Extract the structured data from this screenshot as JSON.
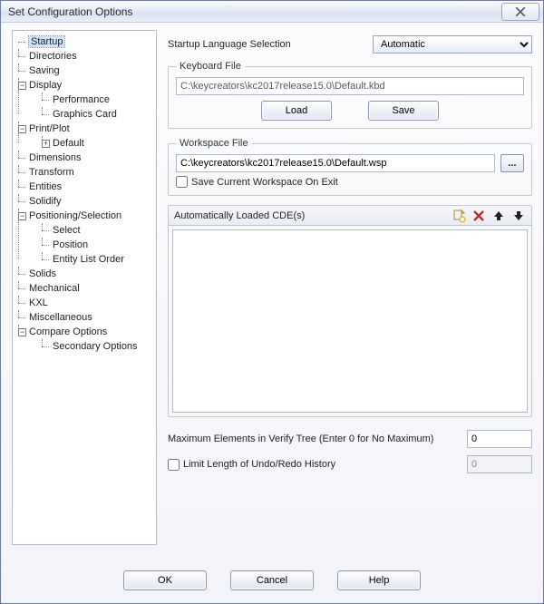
{
  "window": {
    "title": "Set Configuration Options"
  },
  "tree": {
    "items": [
      {
        "label": "Startup",
        "selected": true
      },
      {
        "label": "Directories"
      },
      {
        "label": "Saving"
      },
      {
        "label": "Display",
        "expander": "-",
        "children": [
          {
            "label": "Performance"
          },
          {
            "label": "Graphics Card"
          }
        ]
      },
      {
        "label": "Print/Plot",
        "expander": "-",
        "children": [
          {
            "label": "Default",
            "expander": "+"
          }
        ]
      },
      {
        "label": "Dimensions"
      },
      {
        "label": "Transform"
      },
      {
        "label": "Entities"
      },
      {
        "label": "Solidify"
      },
      {
        "label": "Positioning/Selection",
        "expander": "-",
        "children": [
          {
            "label": "Select"
          },
          {
            "label": "Position"
          },
          {
            "label": "Entity List Order"
          }
        ]
      },
      {
        "label": "Solids"
      },
      {
        "label": "Mechanical"
      },
      {
        "label": "KXL"
      },
      {
        "label": "Miscellaneous"
      },
      {
        "label": "Compare Options",
        "expander": "-",
        "children": [
          {
            "label": "Secondary Options"
          }
        ]
      }
    ]
  },
  "right": {
    "langLabel": "Startup Language Selection",
    "langValue": "Automatic",
    "kbLegend": "Keyboard File",
    "kbPath": "C:\\keycreators\\kc2017release15.0\\Default.kbd",
    "loadLabel": "Load",
    "saveLabel": "Save",
    "wsLegend": "Workspace File",
    "wsPath": "C:\\keycreators\\kc2017release15.0\\Default.wsp",
    "browseLabel": "...",
    "saveWsLabel": "Save Current Workspace On Exit",
    "cdeLabel": "Automatically Loaded CDE(s)",
    "maxLabel": "Maximum Elements in Verify Tree (Enter 0 for No Maximum)",
    "maxValue": "0",
    "undoLabel": "Limit Length of Undo/Redo History",
    "undoValue": "0"
  },
  "footer": {
    "ok": "OK",
    "cancel": "Cancel",
    "help": "Help"
  },
  "icons": {
    "new": "new-file-icon",
    "delete": "delete-icon",
    "moveUp": "arrow-up-icon",
    "moveDown": "arrow-down-icon"
  }
}
